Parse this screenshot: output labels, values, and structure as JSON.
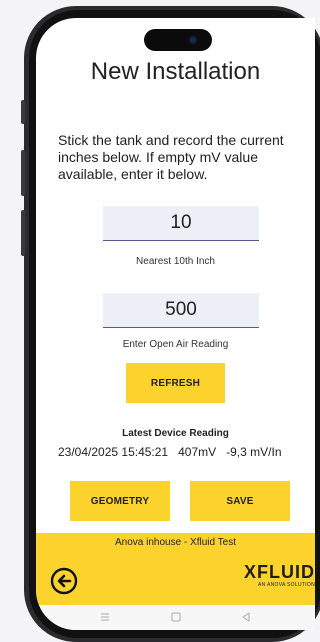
{
  "screen": {
    "title": "New Installation",
    "instructions": "Stick the tank and record the current inches below. If empty mV value available, enter it below."
  },
  "inches_input": {
    "value": "10",
    "caption": "Nearest 10th Inch"
  },
  "air_input": {
    "value": "500",
    "caption": "Enter Open Air Reading"
  },
  "buttons": {
    "refresh": "REFRESH",
    "geometry": "GEOMETRY",
    "save": "SAVE"
  },
  "reading": {
    "title": "Latest Device Reading",
    "timestamp": "23/04/2025 15:45:21",
    "millivolts": "407mV",
    "slope": "-9,3 mV/In"
  },
  "footer": {
    "text": "Anova inhouse - Xfluid Test",
    "logo": "XFLUID",
    "logo_tagline": "AN ANOVA SOLUTION"
  },
  "icons": {
    "back": "back-arrow-circle-icon",
    "nav_menu": "menu-lines-icon",
    "nav_home": "square-home-icon",
    "nav_back": "triangle-back-icon"
  },
  "colors": {
    "accent": "#fcd22c",
    "input_bg": "#eef0f7",
    "text": "#222222"
  }
}
